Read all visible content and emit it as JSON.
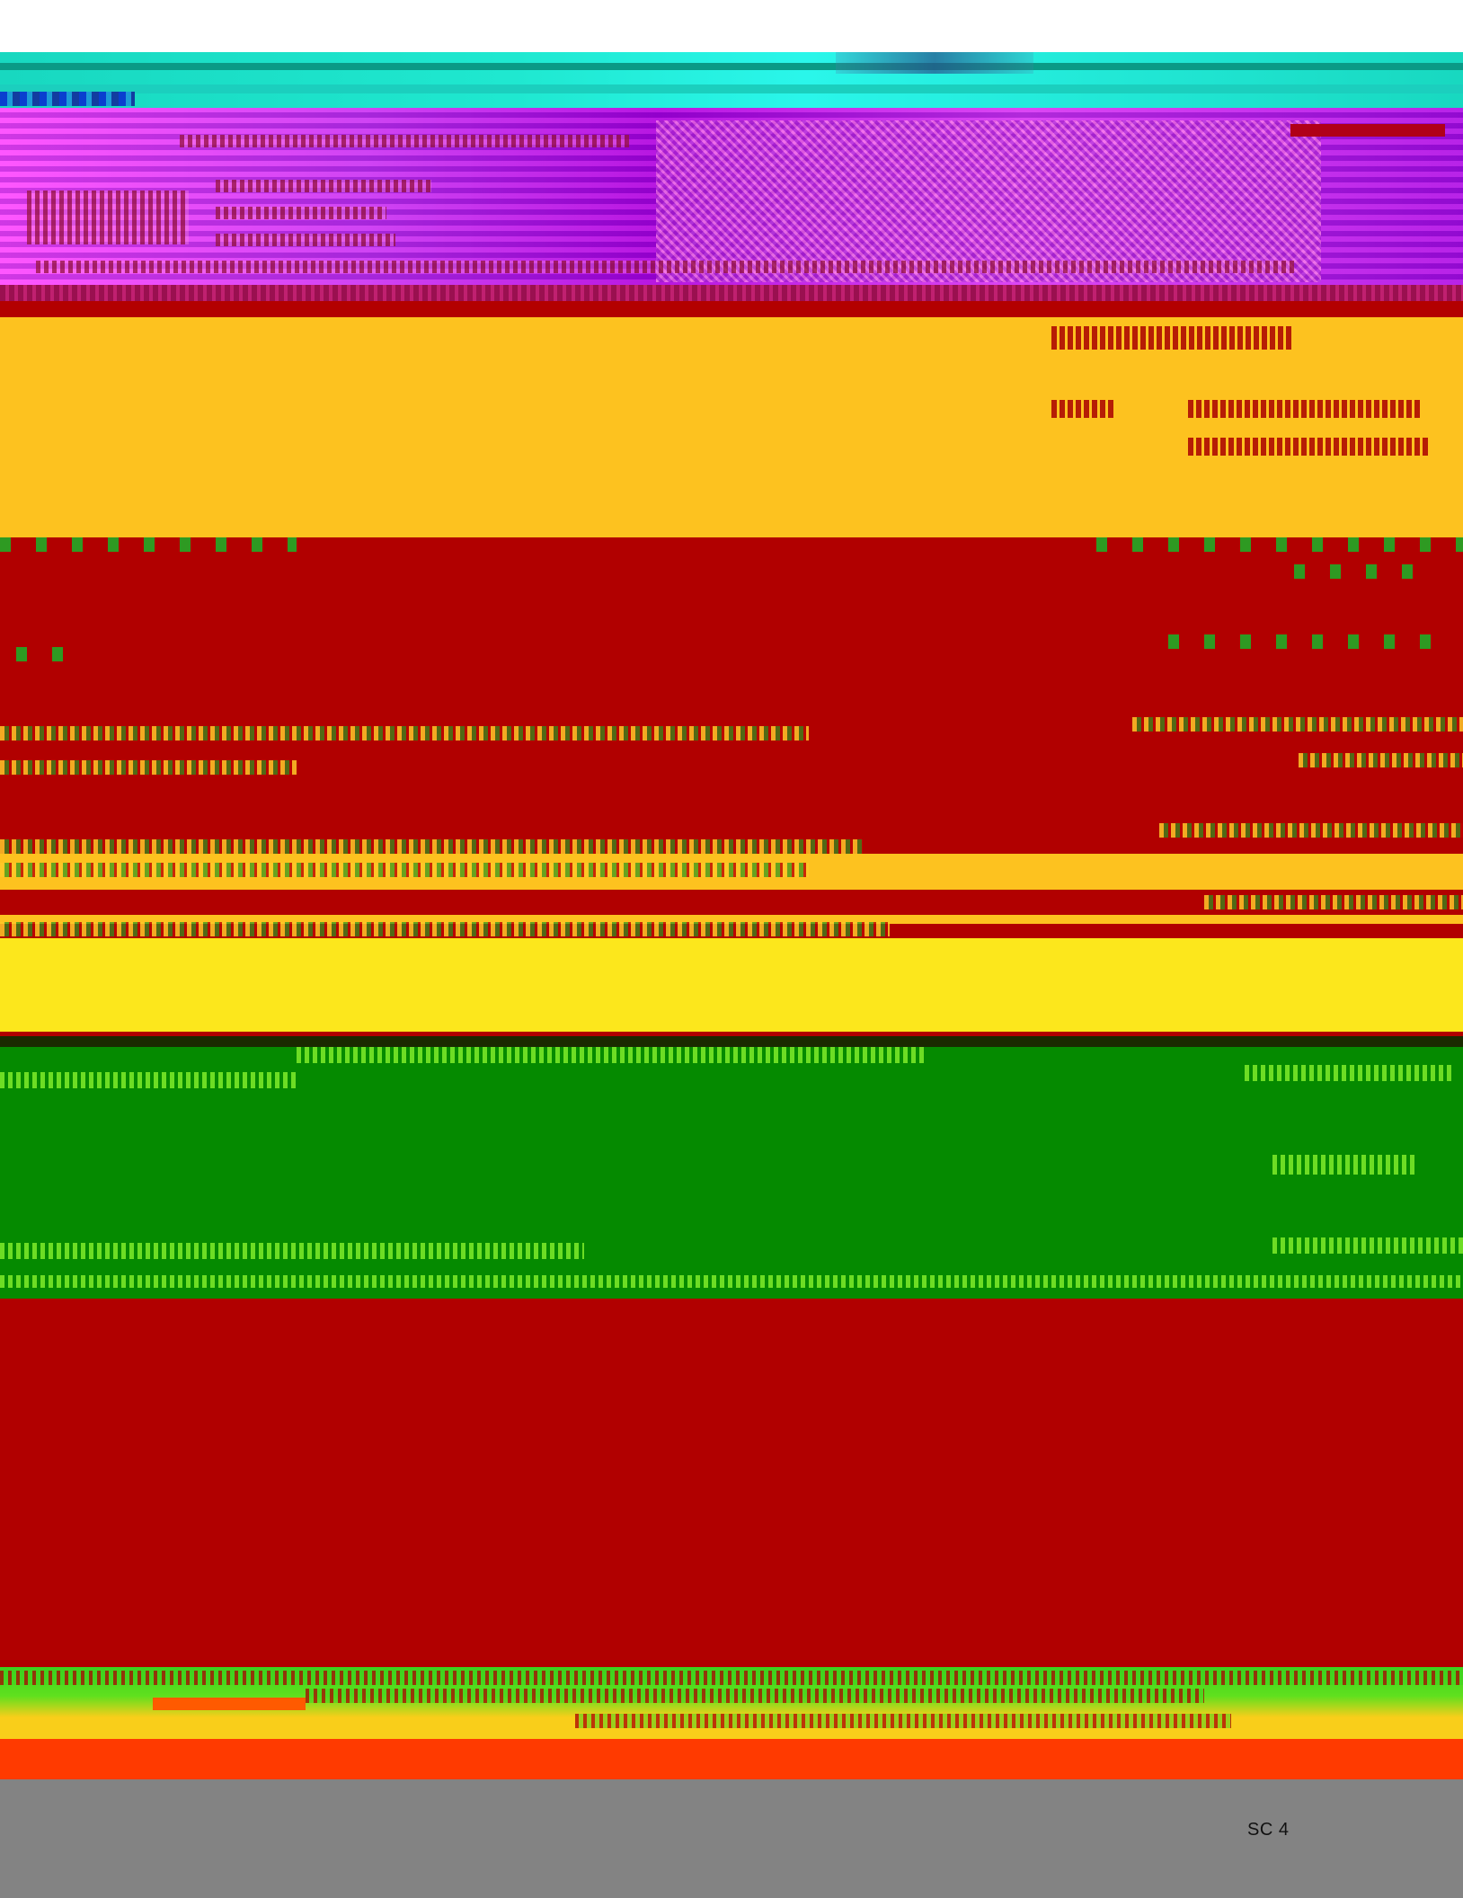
{
  "page": {
    "label": "SC 4"
  },
  "colors": {
    "cyan": "#1fe8d0",
    "magenta": "#c03cf0",
    "red": "#b10000",
    "yellow": "#fdc21f",
    "green": "#058a00",
    "orange": "#ff3a00",
    "grey": "#838383"
  }
}
